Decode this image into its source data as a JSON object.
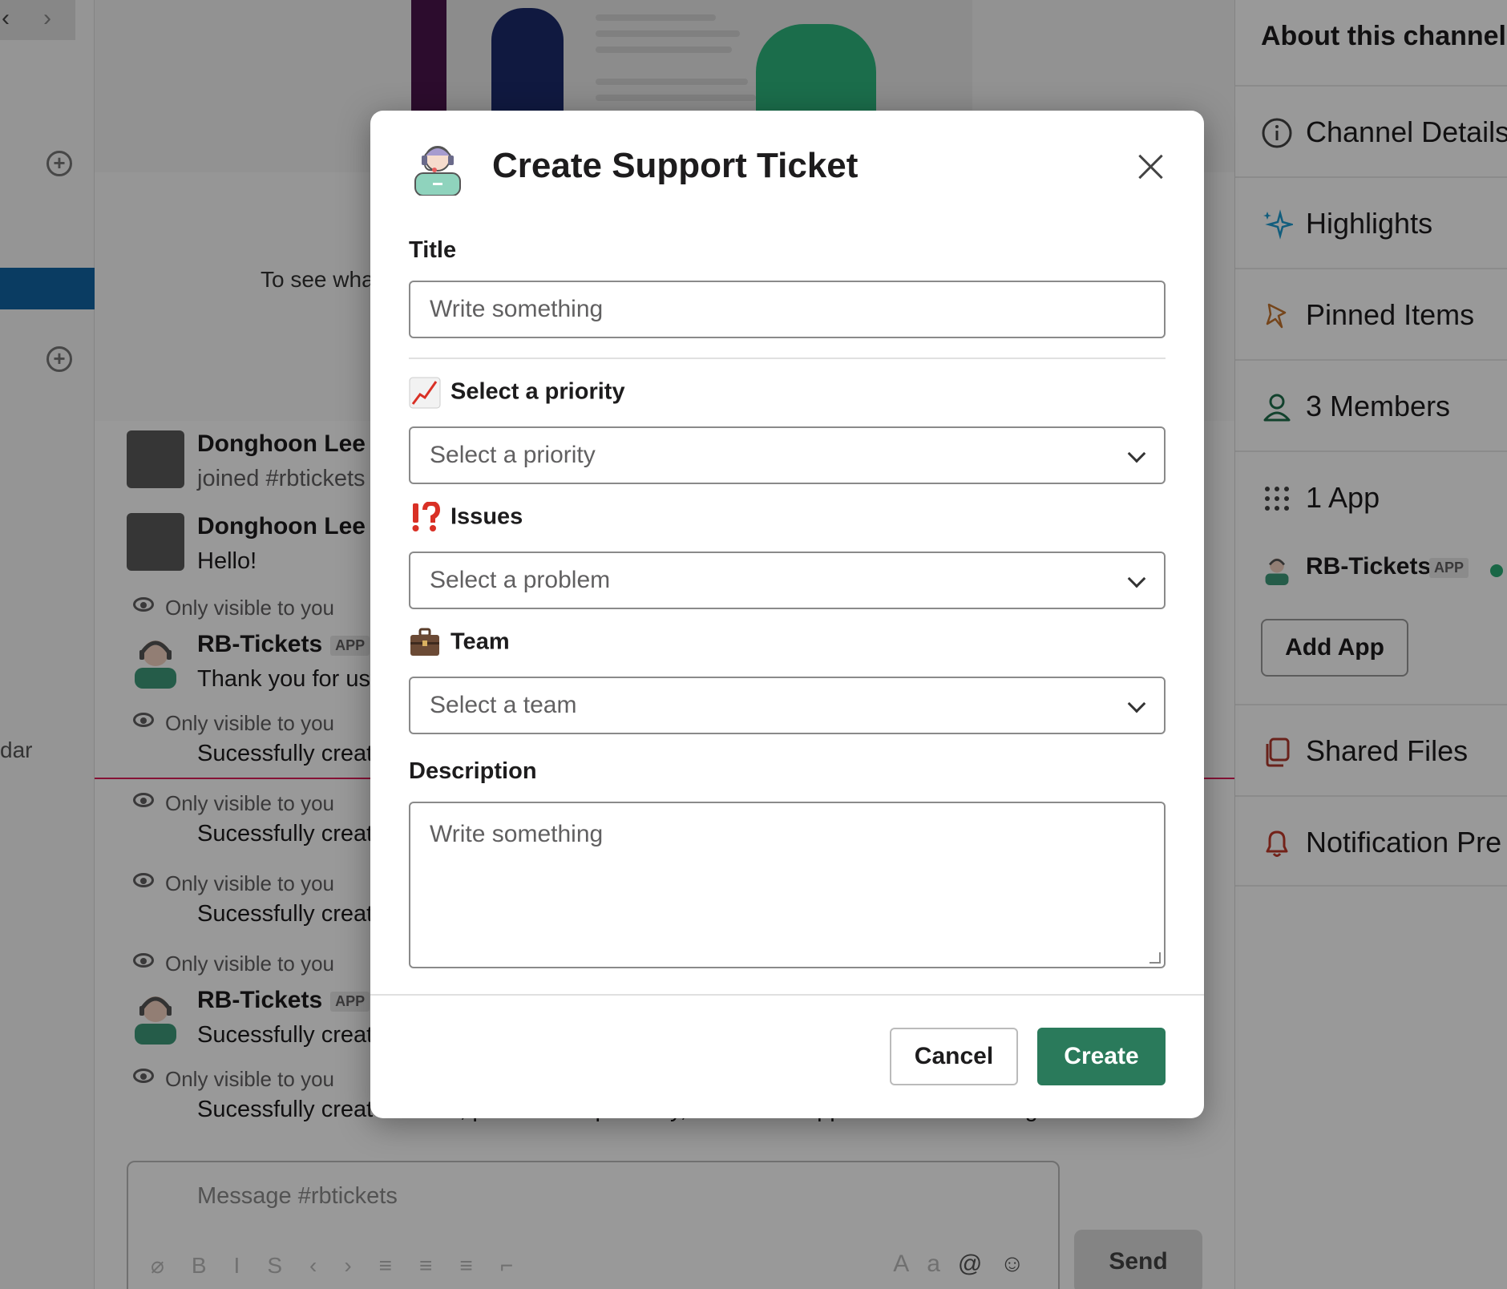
{
  "channel": {
    "intro_text": "To see wha",
    "composer_placeholder": "Message #rbtickets",
    "send_label": "Send",
    "sidebar_partial": "dar"
  },
  "messages": [
    {
      "author": "Donghoon Lee",
      "text": "joined #rbtickets"
    },
    {
      "author": "Donghoon Lee",
      "text": "Hello!"
    },
    {
      "ephemeral": "Only visible to you"
    },
    {
      "author": "RB-Tickets",
      "app_tag": "APP",
      "text": "Thank you for us"
    },
    {
      "ephemeral": "Only visible to you",
      "text": "Sucessfully creat"
    },
    {
      "ephemeral": "Only visible to you",
      "text": "Sucessfully creat"
    },
    {
      "ephemeral": "Only visible to you",
      "text": "Sucessfully creat"
    },
    {
      "ephemeral": "Only visible to you"
    },
    {
      "author": "RB-Tickets",
      "app_tag": "APP",
      "text": "Sucessfully creat"
    },
    {
      "ephemeral": "Only visible to you",
      "text": "Sucessfully created ticket, please wait patiently, while our support team is working hard."
    }
  ],
  "right_panel": {
    "title": "About this channel",
    "items": [
      {
        "label": "Channel Details",
        "icon": "info-icon"
      },
      {
        "label": "Highlights",
        "icon": "sparkle-icon"
      },
      {
        "label": "Pinned Items",
        "icon": "pin-icon"
      },
      {
        "label": "3 Members",
        "icon": "person-icon"
      },
      {
        "label": "1 App",
        "icon": "grid-dots-icon"
      },
      {
        "label": "Shared Files",
        "icon": "files-icon"
      },
      {
        "label": "Notification Pre",
        "icon": "bell-icon"
      }
    ],
    "app_name": "RB-Tickets",
    "app_tag": "APP",
    "add_app": "Add App"
  },
  "modal": {
    "title": "Create Support Ticket",
    "fields": {
      "title_label": "Title",
      "title_placeholder": "Write something",
      "priority_label": "Select a priority",
      "priority_placeholder": "Select a priority",
      "issues_label": "Issues",
      "issues_placeholder": "Select a problem",
      "team_label": "Team",
      "team_placeholder": "Select a team",
      "description_label": "Description",
      "description_placeholder": "Write something"
    },
    "cancel_label": "Cancel",
    "create_label": "Create",
    "colors": {
      "primary": "#2a7a5b"
    }
  }
}
